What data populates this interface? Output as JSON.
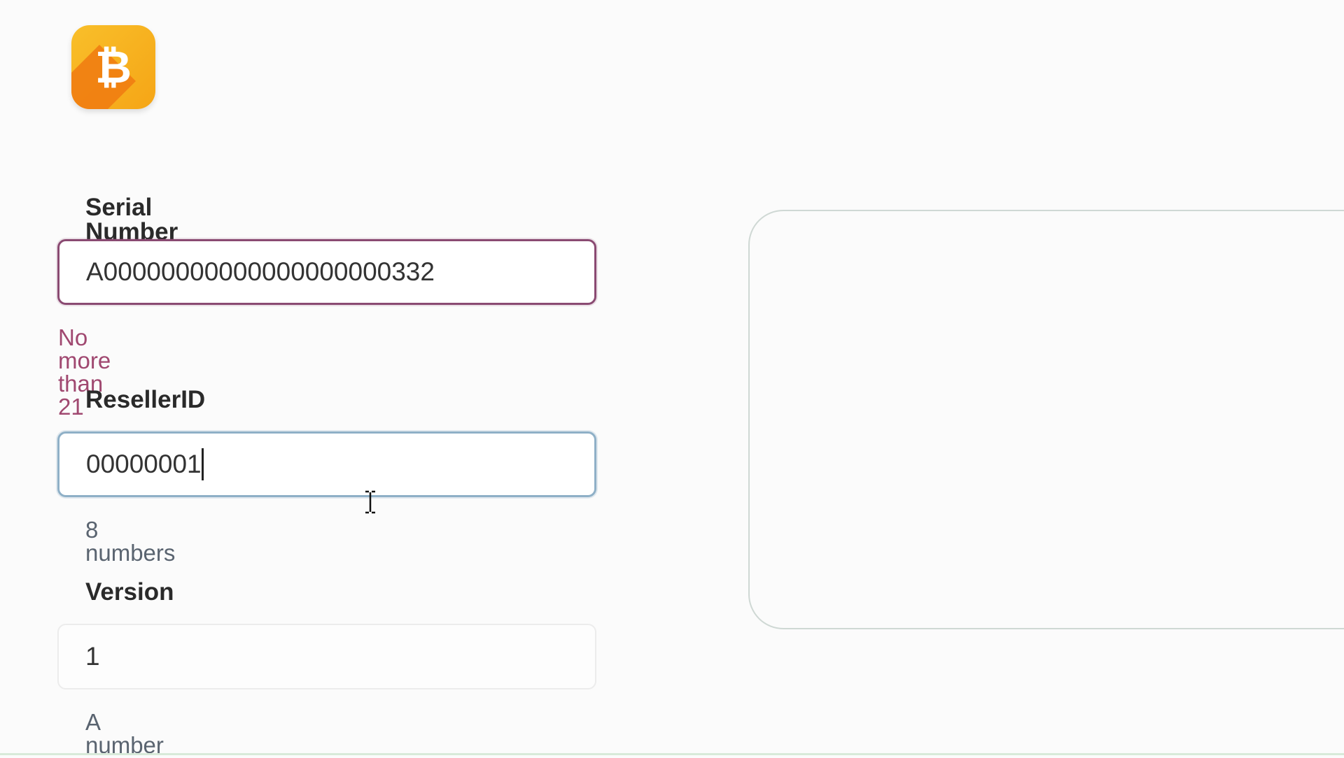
{
  "logo": {
    "icon": "bitcoin-icon",
    "glyph": "₿",
    "colors": {
      "light": "#f7b21e",
      "dark": "#f07a10",
      "glyph": "#ffffff"
    }
  },
  "form": {
    "serial": {
      "label": "Serial Number",
      "value": "A00000000000000000000332",
      "hint": "No more than 21",
      "state": "invalid"
    },
    "reseller": {
      "label": "ResellerID",
      "value": "00000001",
      "hint": "8 numbers",
      "state": "focused"
    },
    "version": {
      "label": "Version",
      "value": "1",
      "hint": "A number",
      "state": "default"
    }
  },
  "colors": {
    "error": "#a04870",
    "error_border": "#8a4a72",
    "focus_border": "#8fb0c7",
    "hint": "#5a6470",
    "panel_border": "#cfd8d4"
  }
}
